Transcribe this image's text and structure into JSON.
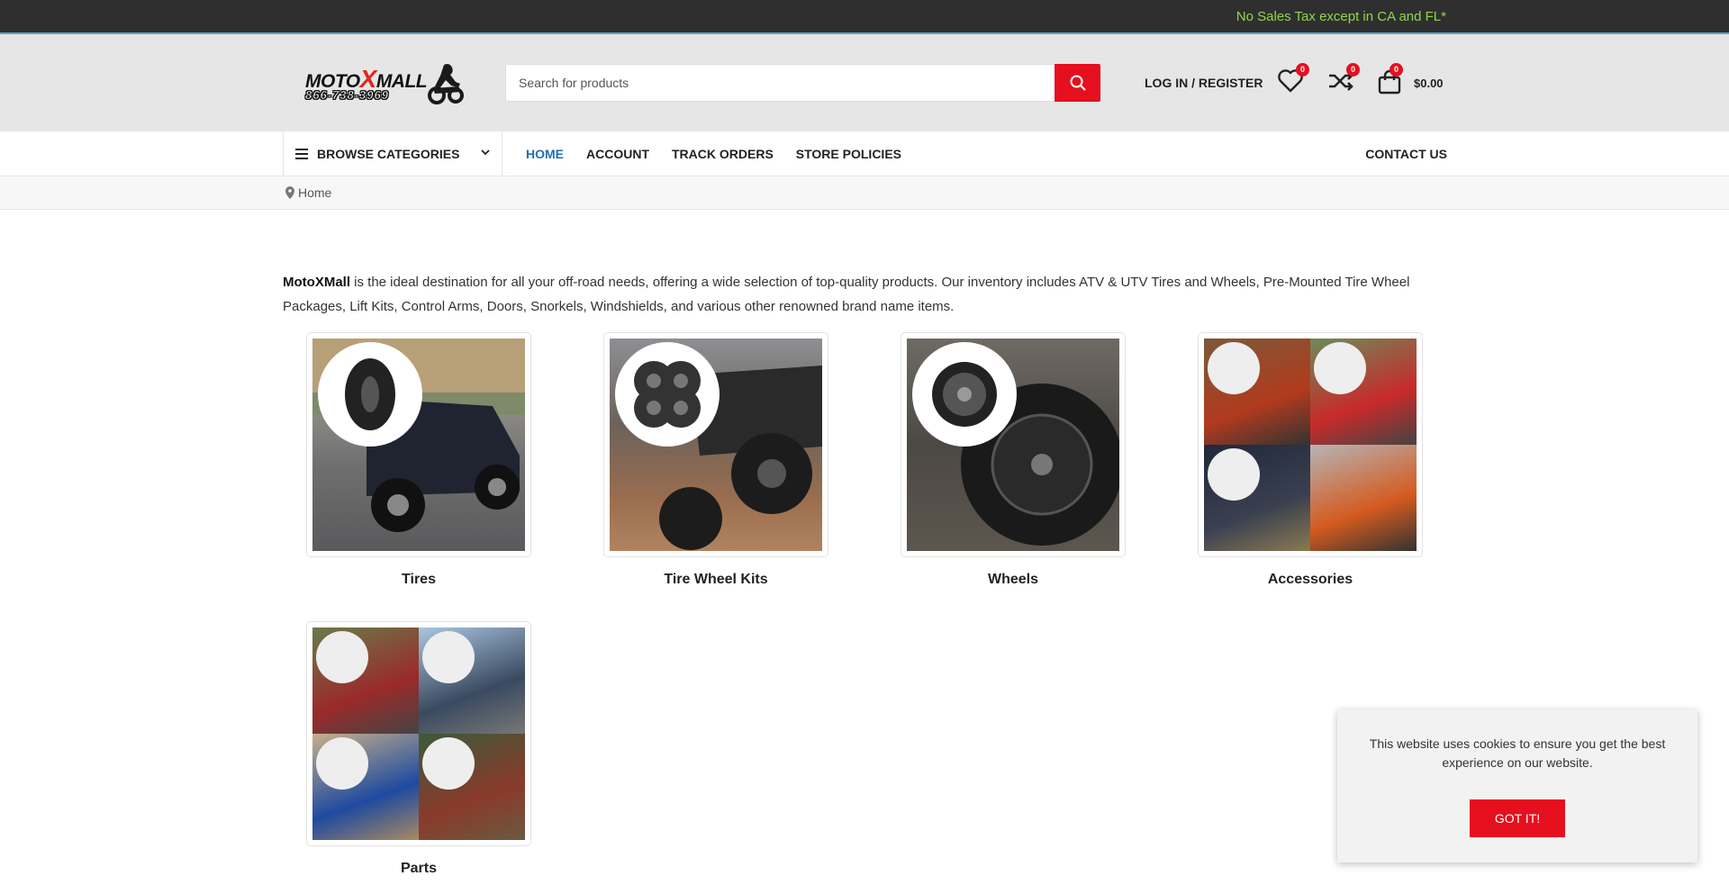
{
  "topbar": {
    "promo": "No Sales Tax except in CA and FL*"
  },
  "header": {
    "logo_brand_left": "MOTO",
    "logo_brand_x": "X",
    "logo_brand_right": "MALL",
    "logo_phone": "866-738-3969",
    "search_placeholder": "Search for products",
    "login_label": "LOG IN / REGISTER",
    "wishlist_count": "0",
    "compare_count": "0",
    "cart_count": "0",
    "cart_total": "$0.00"
  },
  "nav": {
    "browse_label": "BROWSE CATEGORIES",
    "links": [
      {
        "label": "HOME"
      },
      {
        "label": "ACCOUNT"
      },
      {
        "label": "TRACK ORDERS"
      },
      {
        "label": "STORE POLICIES"
      }
    ],
    "contact_label": "CONTACT US"
  },
  "breadcrumb": {
    "home": "Home"
  },
  "intro": {
    "brand": "MotoXMall",
    "text": " is the ideal destination for all your off-road needs, offering a wide selection of top-quality products. Our inventory includes ATV & UTV Tires and Wheels, Pre-Mounted Tire Wheel Packages, Lift Kits, Control Arms, Doors, Snorkels, Windshields, and various other renowned brand name items."
  },
  "categories": [
    {
      "label": "Tires"
    },
    {
      "label": "Tire Wheel Kits"
    },
    {
      "label": "Wheels"
    },
    {
      "label": "Accessories"
    },
    {
      "label": "Parts"
    }
  ],
  "cookie": {
    "message": "This website uses cookies to ensure you get the best experience on our website.",
    "button": "GOT IT!"
  },
  "colors": {
    "accent_red": "#e60f1e",
    "nav_active": "#1f6fb3",
    "promo_green": "#8fd64a",
    "topbar_bg": "#2f2f2f"
  }
}
